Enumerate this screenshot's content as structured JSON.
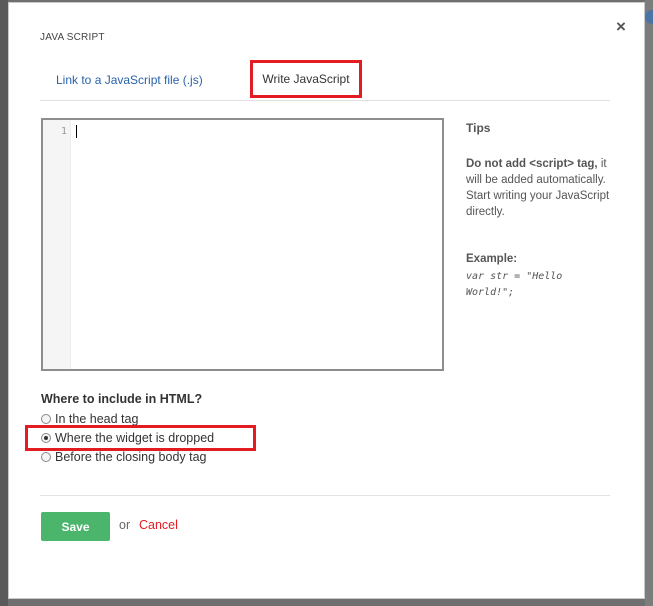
{
  "dialog": {
    "title": "JAVA SCRIPT",
    "close_icon": "×"
  },
  "tabs": [
    {
      "label": "Link to a JavaScript file (.js)",
      "active": false
    },
    {
      "label": "Write JavaScript",
      "active": true
    }
  ],
  "editor": {
    "line_number": "1",
    "content": ""
  },
  "tips": {
    "title": "Tips",
    "text_bold": "Do not add <script> tag,",
    "text_rest": "it will be added automatically. Start writing your JavaScript directly.",
    "example_label": "Example:",
    "example_code": "var str = \"Hello World!\";"
  },
  "include": {
    "title": "Where to include in HTML?",
    "options": [
      {
        "label": "In the head tag",
        "checked": false
      },
      {
        "label": "Where the widget is dropped",
        "checked": true
      },
      {
        "label": "Before the closing body tag",
        "checked": false
      }
    ]
  },
  "footer": {
    "save_label": "Save",
    "or_label": "or",
    "cancel_label": "Cancel"
  },
  "colors": {
    "highlight": "#e31b23",
    "save_button": "#4cb56c",
    "link": "#2a63a8"
  }
}
